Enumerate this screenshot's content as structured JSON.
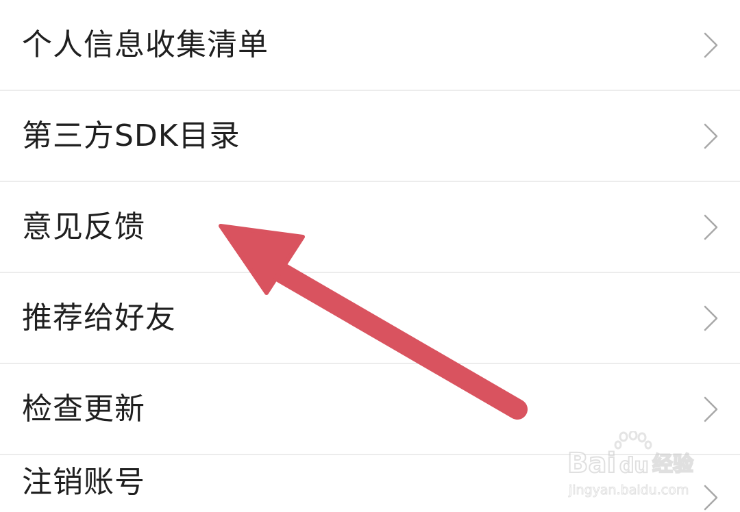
{
  "menu": {
    "items": [
      {
        "label": "个人信息收集清单",
        "icon": "chevron-right-icon"
      },
      {
        "label": "第三方SDK目录",
        "icon": "chevron-right-icon"
      },
      {
        "label": "意见反馈",
        "icon": "chevron-right-icon"
      },
      {
        "label": "推荐给好友",
        "icon": "chevron-right-icon"
      },
      {
        "label": "检查更新",
        "icon": "chevron-right-icon"
      },
      {
        "label": "注销账号",
        "icon": "chevron-right-icon"
      }
    ]
  },
  "annotation": {
    "icon": "arrow-icon",
    "color": "#d9535f"
  },
  "watermark": {
    "brand": "Bai du 经验",
    "url": "jingyan.baidu.com"
  }
}
